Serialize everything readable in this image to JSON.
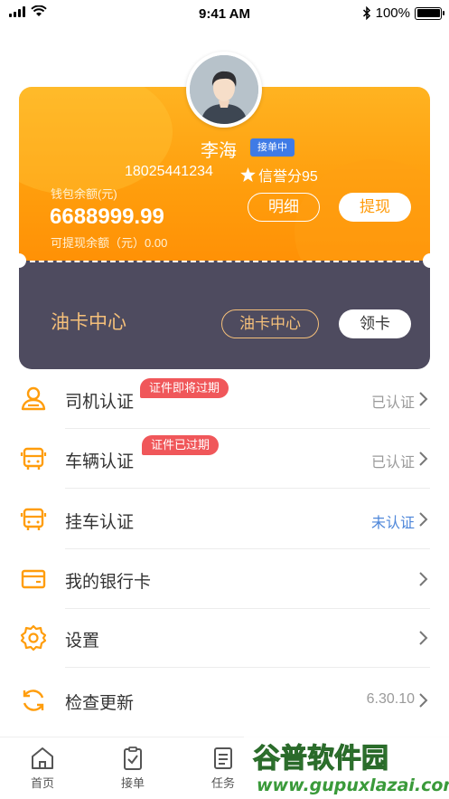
{
  "status_bar": {
    "time": "9:41 AM",
    "battery": "100%"
  },
  "colors": {
    "accent": "#ff9d0c",
    "card_dark": "#4e4b5f",
    "oil_text": "#f5c07a",
    "warn": "#f0575a",
    "link_blue": "#4d86d9"
  },
  "profile": {
    "name": "李海",
    "status_badge": "接单中",
    "phone": "18025441234",
    "credit": "信誉分95"
  },
  "wallet": {
    "balance_label": "钱包余额(元)",
    "balance": "6688999.99",
    "withdrawable": "可提现余额（元）0.00",
    "detail_button": "明细",
    "withdraw_button": "提现"
  },
  "oil_card": {
    "title": "油卡中心",
    "center_button": "油卡中心",
    "get_card_button": "领卡"
  },
  "menu": [
    {
      "label": "司机认证",
      "value": "已认证",
      "tag": "证件即将过期",
      "icon": "driver-icon"
    },
    {
      "label": "车辆认证",
      "value": "已认证",
      "tag": "证件已过期",
      "icon": "truck-icon"
    },
    {
      "label": "挂车认证",
      "value": "未认证",
      "icon": "trailer-icon"
    },
    {
      "label": "我的银行卡",
      "value": "",
      "icon": "bank-card-icon"
    },
    {
      "label": "设置",
      "value": "",
      "icon": "gear-icon"
    },
    {
      "label": "检查更新",
      "value": "6.30.10",
      "icon": "refresh-icon"
    }
  ],
  "tabs": [
    {
      "label": "首页",
      "icon": "home-icon"
    },
    {
      "label": "接单",
      "icon": "clipboard-icon"
    },
    {
      "label": "任务",
      "icon": "list-icon"
    }
  ],
  "watermark": {
    "text": "谷普软件园",
    "url": "www.gupuxlazai.com"
  }
}
